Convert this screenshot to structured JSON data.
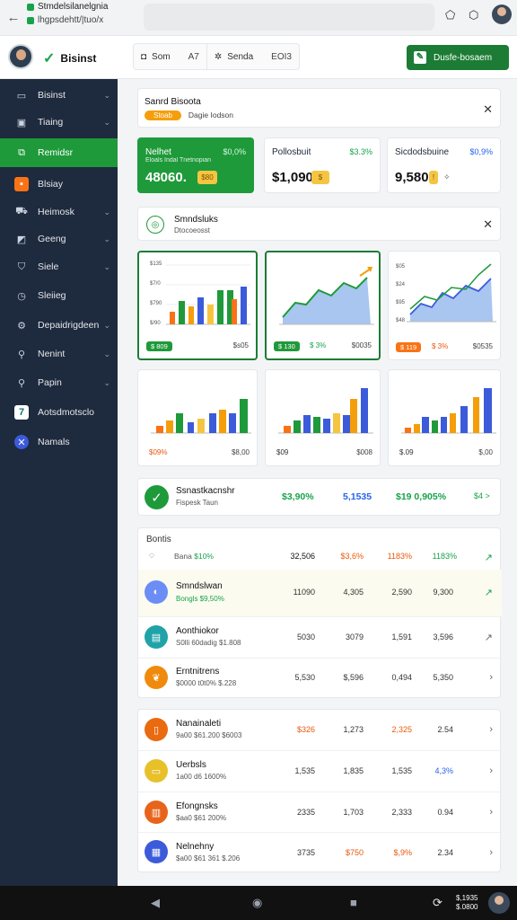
{
  "browser": {
    "tab_title": "Stmdelsilanelgnia",
    "tab_url": "lhgpsdehtt/|tuo/x"
  },
  "header": {
    "brand": "Bisinst",
    "seg1_label": "Som",
    "seg1_value": "A7",
    "seg2_label": "Senda",
    "seg2_value": "EOI3",
    "cta_label": "Dusfe-bosaem"
  },
  "sidebar": {
    "items": [
      {
        "label": "Bisinst",
        "icon": "briefcase-icon"
      },
      {
        "label": "Tiaing",
        "icon": "id-card-icon"
      },
      {
        "label": "Remidsr",
        "icon": "analytics-icon"
      },
      {
        "label": "Blsiay",
        "icon": "tag-icon"
      },
      {
        "label": "Heimosk",
        "icon": "car-icon"
      },
      {
        "label": "Geeng",
        "icon": "image-icon"
      },
      {
        "label": "Siele",
        "icon": "shield-icon"
      },
      {
        "label": "Sleiieg",
        "icon": "clock-icon"
      },
      {
        "label": "Depaidrigdeen",
        "icon": "gear-icon"
      },
      {
        "label": "Nenint",
        "icon": "magnifier-icon"
      },
      {
        "label": "Papin",
        "icon": "search-icon"
      },
      {
        "label": "Aotsdmotsclo",
        "icon": "seven-icon"
      },
      {
        "label": "Namals",
        "icon": "tools-icon"
      }
    ]
  },
  "notice": {
    "title": "Sanrd Bisoota",
    "pill": "Stoab",
    "text": "Dagie Iodson"
  },
  "stats": [
    {
      "label": "Nelhet",
      "sub": "Eloals Indal Tnetnopian",
      "pct": "$0,0%",
      "value": "48060.",
      "badge": "$80"
    },
    {
      "label": "Pollosbuit",
      "sub": "",
      "pct": "$3.3%",
      "value": "$1,090",
      "badge": "$"
    },
    {
      "label": "Sicdodsbuine",
      "sub": "",
      "pct": "$0,9%",
      "value": "9,580",
      "badge": "!"
    }
  ],
  "charts_header": {
    "title": "Smndsluks",
    "sub": "Dtocoeosst"
  },
  "charts_row1": [
    {
      "tag": "$ 809",
      "mid": "",
      "right": "$s05",
      "ylabels": [
        "$135",
        "$7/0",
        "$790",
        "$/90"
      ]
    },
    {
      "tag": "$ 130",
      "mid": "$ 3%",
      "right": "$0035",
      "ylabels": []
    },
    {
      "tag": "$ 119",
      "mid": "$ 3%",
      "right": "$0535",
      "ylabels": [
        "$05",
        "$24",
        "$95",
        "$48"
      ]
    }
  ],
  "charts_row2": [
    {
      "left": "$09%",
      "right": "$8,00"
    },
    {
      "left": "$09",
      "right": "$008"
    },
    {
      "left": "$.09",
      "right": "$,00"
    }
  ],
  "summary": {
    "title": "Ssnastkacnshr",
    "sub": "Fispesk Taun",
    "v1": "$3,90%",
    "v2": "5,1535",
    "v3": "$19 0,905%",
    "v4": "$4 >"
  },
  "table1": {
    "title": "Bontis",
    "head_label": "Bana",
    "head_label_green": "$10%",
    "head": [
      "32,506",
      "$3,6%",
      "1183%",
      "1183%"
    ],
    "rows": [
      {
        "name": "Smndslwan",
        "sub_green": "Bongls $9,50%",
        "sub": "",
        "cols": [
          "11090",
          "4,305",
          "2,590",
          "9,300"
        ],
        "icon": "s-icon"
      },
      {
        "name": "Aonthiokor",
        "sub_green": "",
        "sub": "S0lli 60dadig $1.808",
        "cols": [
          "5030",
          "3079",
          "1,591",
          "3,596"
        ],
        "icon": "wallet-icon"
      },
      {
        "name": "Erntnitrens",
        "sub_green": "",
        "sub": "$0000 t0t0%  $.228",
        "cols": [
          "5,530",
          "$,596",
          "0,494",
          "5,350"
        ],
        "icon": "leaf-icon"
      }
    ]
  },
  "table2": {
    "rows": [
      {
        "name": "Nanainaleti",
        "sub": "9a00 $61.200  $6003",
        "cols": [
          "$326",
          "1,273",
          "2,325",
          "2.54"
        ],
        "icon": "doc-icon"
      },
      {
        "name": "Uerbsls",
        "sub": "1a00 d6 1600%",
        "cols": [
          "1,535",
          "1,835",
          "1,535",
          "4,3%"
        ],
        "icon": "folder-icon"
      },
      {
        "name": "Efongnsks",
        "sub": "$aa0 $61 200%",
        "cols": [
          "2335",
          "1,703",
          "2,333",
          "0.94"
        ],
        "icon": "table-icon"
      },
      {
        "name": "Nelnehny",
        "sub": "$a00 $61 361  $.206",
        "cols": [
          "3735",
          "$750",
          "$,9%",
          "2.34"
        ],
        "icon": "grid-icon"
      }
    ]
  },
  "nav": {
    "clock_line1": "$,1935",
    "clock_line2": "$.0800"
  },
  "colors": {
    "brand_green": "#1f9a3a",
    "sidebar_bg": "#1e2a3d",
    "accent_orange": "#f97316",
    "accent_blue": "#2563eb"
  }
}
